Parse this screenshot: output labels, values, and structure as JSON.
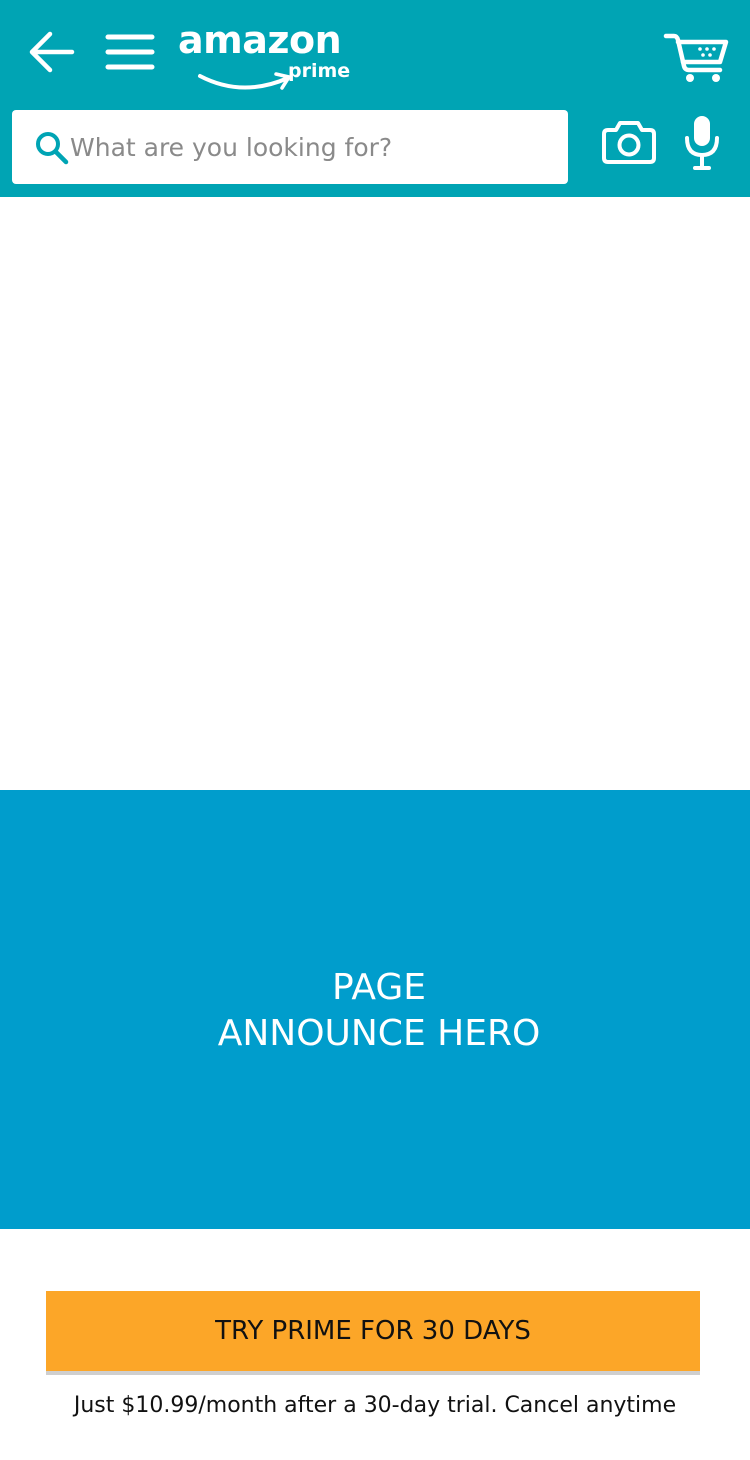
{
  "header": {
    "logo_text": "amazon",
    "logo_subtext": "prime",
    "background_color": "#00a4b4",
    "icons": {
      "back": "back-arrow-icon",
      "menu": "hamburger-menu-icon",
      "cart": "cart-icon",
      "camera": "camera-icon",
      "mic": "microphone-icon",
      "search": "search-icon"
    }
  },
  "search": {
    "placeholder": "What are you looking for?",
    "value": ""
  },
  "hero": {
    "line1": "PAGE",
    "line2": "ANNOUNCE HERO",
    "background_color": "#009dcc"
  },
  "cta": {
    "label": "TRY PRIME FOR 30 DAYS",
    "color": "#fca628"
  },
  "fine_print": "Just $10.99/month after a 30-day trial. Cancel anytime"
}
